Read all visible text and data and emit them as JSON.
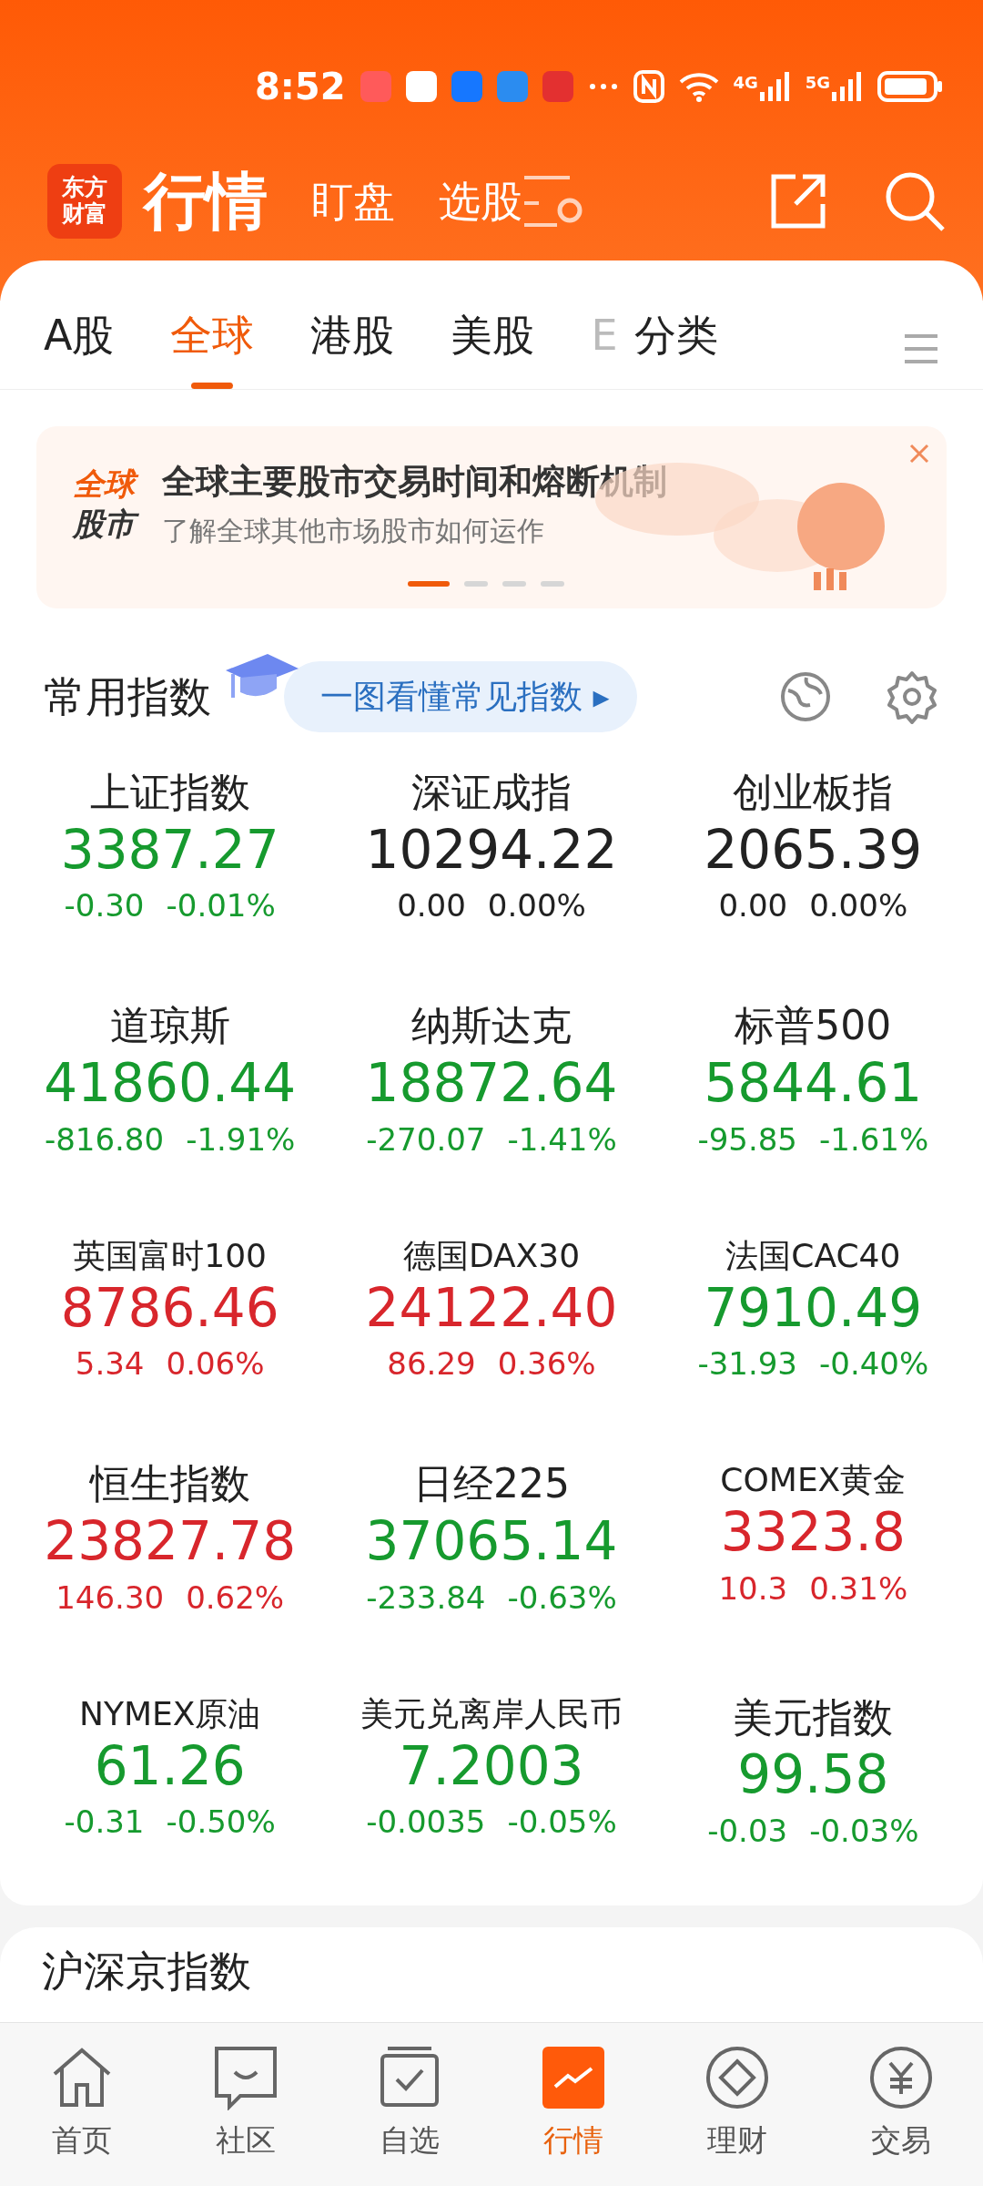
{
  "status_bar": {
    "time": "8:52",
    "network_1": "4G",
    "network_2": "5G"
  },
  "header": {
    "logo": "东方财富",
    "title": "行情",
    "links": [
      "盯盘",
      "选股"
    ]
  },
  "tabs": [
    {
      "label": "A股",
      "selected": false
    },
    {
      "label": "全球",
      "selected": true
    },
    {
      "label": "港股",
      "selected": false
    },
    {
      "label": "美股",
      "selected": false
    },
    {
      "label": "E",
      "selected": false
    },
    {
      "label": "分类",
      "selected": false
    }
  ],
  "banner": {
    "badge_top": "全球",
    "badge_bottom": "股市",
    "title": "全球主要股市交易时间和熔断机制",
    "subtitle": "了解全球其他市场股市如何运作",
    "pages": [
      {
        "selected": true
      },
      {
        "selected": false
      },
      {
        "selected": false
      },
      {
        "selected": false
      }
    ]
  },
  "section": {
    "title": "常用指数",
    "guide": "一图看懂常见指数 ▸"
  },
  "indices": [
    {
      "name": "上证指数",
      "price": "3387.27",
      "change": "-0.30",
      "pct": "-0.01%",
      "color": "#169a2e"
    },
    {
      "name": "深证成指",
      "price": "10294.22",
      "change": "0.00",
      "pct": "0.00%",
      "color": "#222222"
    },
    {
      "name": "创业板指",
      "price": "2065.39",
      "change": "0.00",
      "pct": "0.00%",
      "color": "#222222"
    },
    {
      "name": "道琼斯",
      "price": "41860.44",
      "change": "-816.80",
      "pct": "-1.91%",
      "color": "#169a2e"
    },
    {
      "name": "纳斯达克",
      "price": "18872.64",
      "change": "-270.07",
      "pct": "-1.41%",
      "color": "#169a2e"
    },
    {
      "name": "标普500",
      "price": "5844.61",
      "change": "-95.85",
      "pct": "-1.61%",
      "color": "#169a2e"
    },
    {
      "name": "英国富时100",
      "price": "8786.46",
      "change": "5.34",
      "pct": "0.06%",
      "color": "#d8262c"
    },
    {
      "name": "德国DAX30",
      "price": "24122.40",
      "change": "86.29",
      "pct": "0.36%",
      "color": "#d8262c"
    },
    {
      "name": "法国CAC40",
      "price": "7910.49",
      "change": "-31.93",
      "pct": "-0.40%",
      "color": "#169a2e"
    },
    {
      "name": "恒生指数",
      "price": "23827.78",
      "change": "146.30",
      "pct": "0.62%",
      "color": "#d8262c"
    },
    {
      "name": "日经225",
      "price": "37065.14",
      "change": "-233.84",
      "pct": "-0.63%",
      "color": "#169a2e"
    },
    {
      "name": "COMEX黄金",
      "price": "3323.8",
      "change": "10.3",
      "pct": "0.31%",
      "color": "#d8262c"
    },
    {
      "name": "NYMEX原油",
      "price": "61.26",
      "change": "-0.31",
      "pct": "-0.50%",
      "color": "#169a2e"
    },
    {
      "name": "美元兑离岸人民币",
      "price": "7.2003",
      "change": "-0.0035",
      "pct": "-0.05%",
      "color": "#169a2e"
    },
    {
      "name": "美元指数",
      "price": "99.58",
      "change": "-0.03",
      "pct": "-0.03%",
      "color": "#169a2e"
    }
  ],
  "next_section": {
    "title": "沪深京指数"
  },
  "bottom_nav": [
    {
      "label": "首页",
      "selected": false
    },
    {
      "label": "社区",
      "selected": false
    },
    {
      "label": "自选",
      "selected": false
    },
    {
      "label": "行情",
      "selected": true
    },
    {
      "label": "理财",
      "selected": false
    },
    {
      "label": "交易",
      "selected": false
    }
  ]
}
